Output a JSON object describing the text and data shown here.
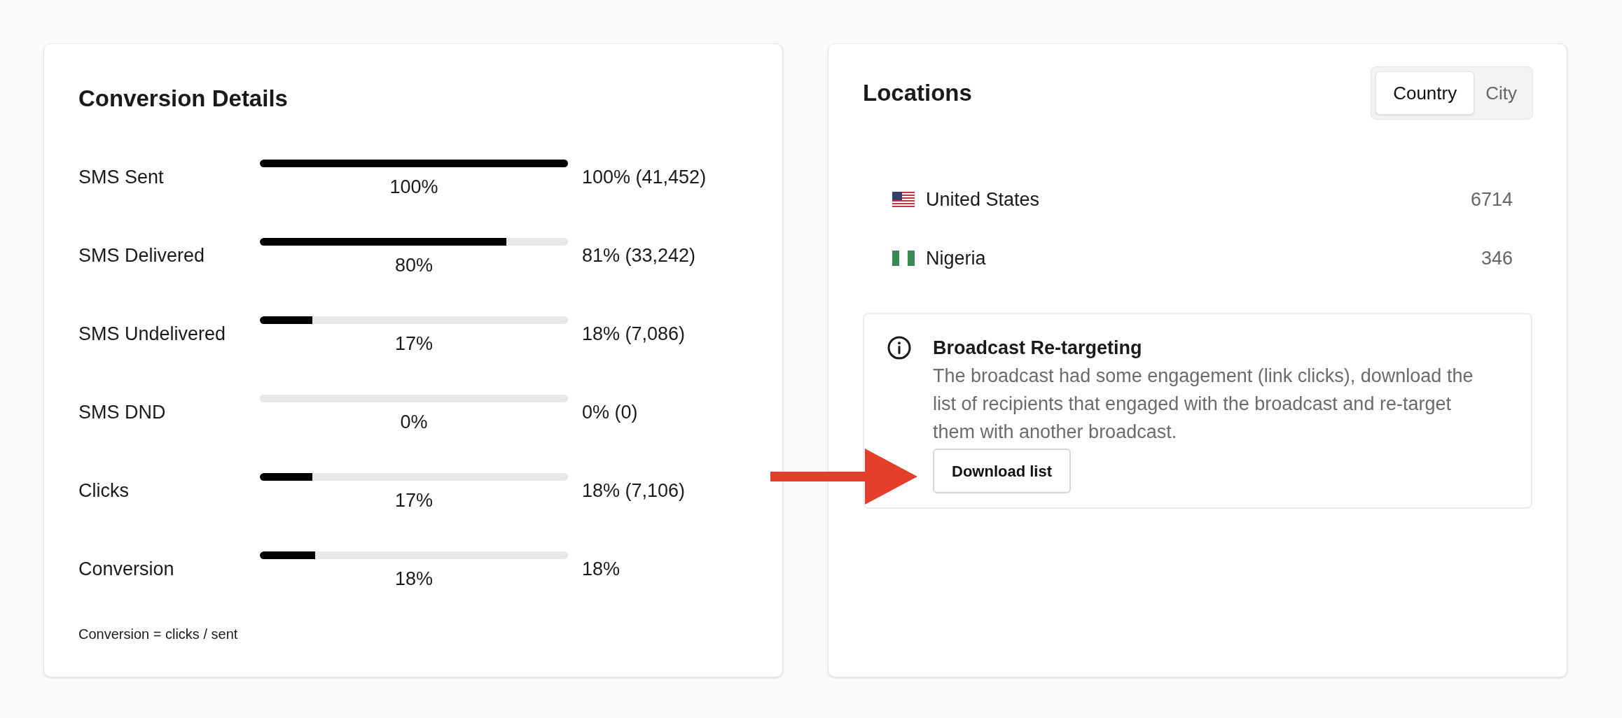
{
  "conversion": {
    "title": "Conversion Details",
    "rows": [
      {
        "label": "SMS Sent",
        "level": 1,
        "percent": "100%",
        "value": "100% (41,452)"
      },
      {
        "label": "SMS Delivered",
        "level": 0.8,
        "percent": "80%",
        "value": "81% (33,242)"
      },
      {
        "label": "SMS Undelivered",
        "level": 0.17,
        "percent": "17%",
        "value": "18% (7,086)"
      },
      {
        "label": "SMS DND",
        "level": 0,
        "percent": "0%",
        "value": "0% (0)"
      },
      {
        "label": "Clicks",
        "level": 0.17,
        "percent": "17%",
        "value": "18% (7,106)"
      },
      {
        "label": "Conversion",
        "level": 0.18,
        "percent": "18%",
        "value": "18%"
      }
    ],
    "footnote": "Conversion = clicks / sent"
  },
  "locations": {
    "title": "Locations",
    "tabs": [
      {
        "label": "Country",
        "selected": true
      },
      {
        "label": "City",
        "selected": false
      }
    ],
    "items": [
      {
        "kind": "us",
        "name": "United States",
        "count": "6714"
      },
      {
        "kind": "ng",
        "name": "Nigeria",
        "count": "346"
      }
    ],
    "retargeting": {
      "title": "Broadcast Re-targeting",
      "text": "The broadcast had some engagement (link clicks), download the list of recipients that engaged with the broadcast and re-target them with another broadcast.",
      "button": "Download list"
    }
  }
}
